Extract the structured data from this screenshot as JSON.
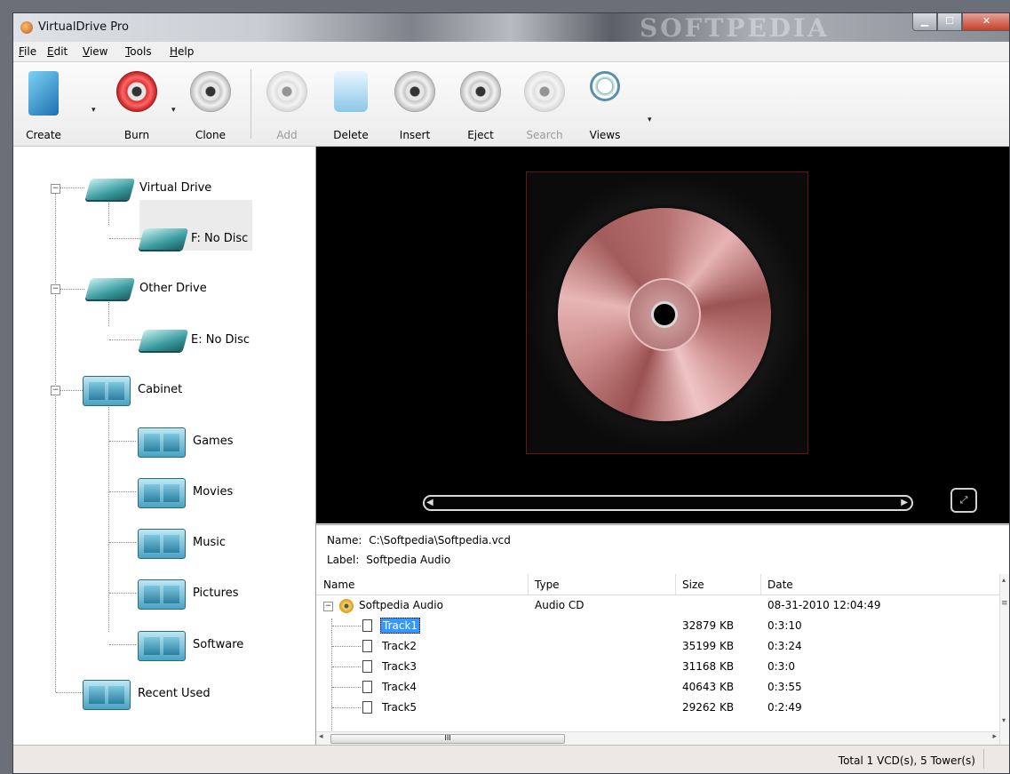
{
  "window": {
    "title": "VirtualDrive Pro",
    "watermark": "SOFTPEDIA",
    "controls": {
      "minimize": "▁",
      "maximize": "☐",
      "close": "✕"
    }
  },
  "menu": [
    {
      "label": "File",
      "accel": "F",
      "rest": "ile"
    },
    {
      "label": "Edit",
      "accel": "E",
      "rest": "dit"
    },
    {
      "label": "View",
      "accel": "V",
      "rest": "iew"
    },
    {
      "label": "Tools",
      "accel": "T",
      "rest": "ools"
    },
    {
      "label": "Help",
      "accel": "H",
      "rest": "elp"
    }
  ],
  "toolbar": {
    "create": "Create",
    "burn": "Burn",
    "clone": "Clone",
    "add": "Add",
    "delete": "Delete",
    "insert": "Insert",
    "eject": "Eject",
    "search": "Search",
    "views": "Views"
  },
  "tree": {
    "virtual_drive": "Virtual Drive",
    "f_drive": "F: No Disc",
    "other_drive": "Other Drive",
    "e_drive": "E: No Disc",
    "cabinet": "Cabinet",
    "games": "Games",
    "movies": "Movies",
    "music": "Music",
    "pictures": "Pictures",
    "software": "Software",
    "recent": "Recent Used"
  },
  "info": {
    "name_label": "Name:",
    "name_value": "C:\\Softpedia\\Softpedia.vcd",
    "label_label": "Label:",
    "label_value": "Softpedia Audio"
  },
  "table": {
    "columns": [
      "Name",
      "Type",
      "Size",
      "Date"
    ],
    "root": {
      "name": "Softpedia Audio",
      "type": "Audio CD",
      "size": "",
      "date": "08-31-2010 12:04:49"
    },
    "tracks": [
      {
        "name": "Track1",
        "size": "32879 KB",
        "date": "0:3:10"
      },
      {
        "name": "Track2",
        "size": "35199 KB",
        "date": "0:3:24"
      },
      {
        "name": "Track3",
        "size": "31168 KB",
        "date": "0:3:0"
      },
      {
        "name": "Track4",
        "size": "40643 KB",
        "date": "0:3:55"
      },
      {
        "name": "Track5",
        "size": "29262 KB",
        "date": "0:2:49"
      }
    ],
    "hscroll_grip": "III"
  },
  "status": {
    "text": "Total 1 VCD(s), 5 Tower(s)"
  }
}
